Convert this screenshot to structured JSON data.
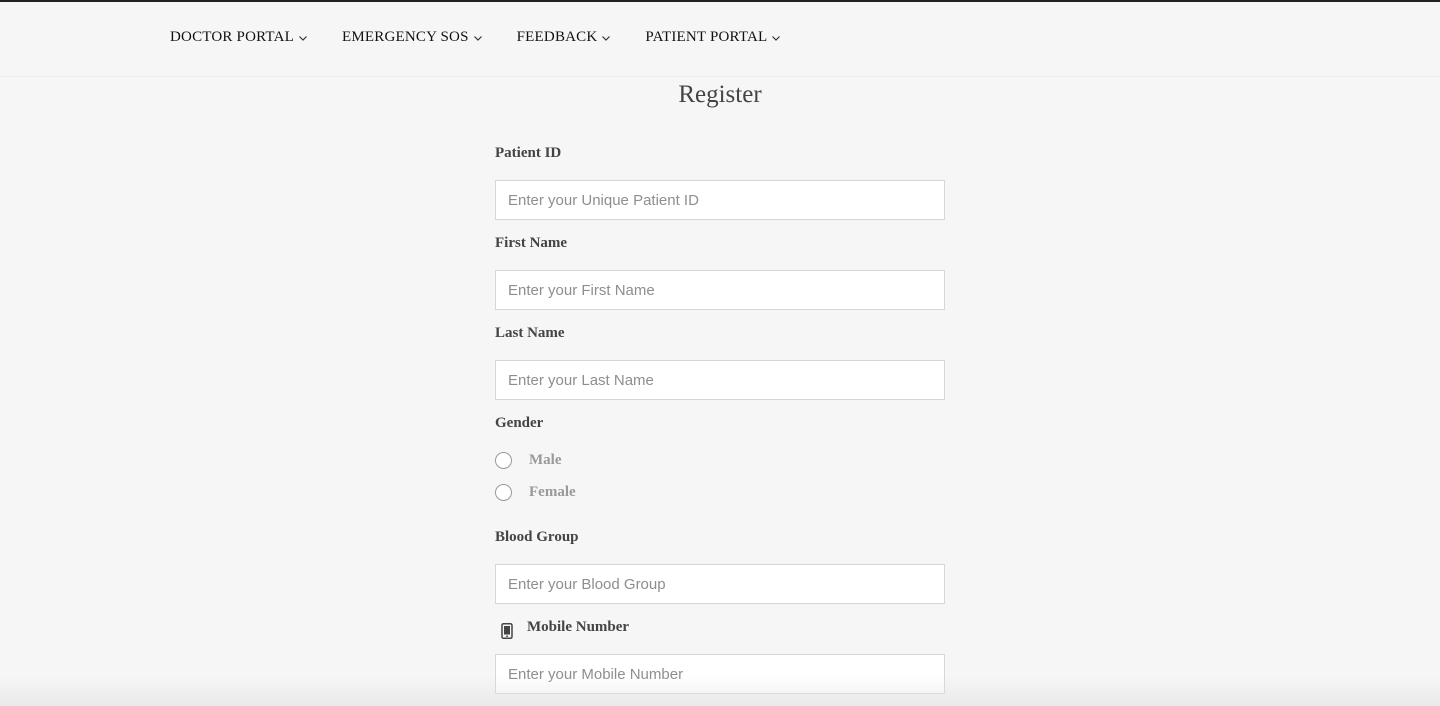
{
  "nav": {
    "items": [
      {
        "label": "DOCTOR PORTAL"
      },
      {
        "label": "EMERGENCY SOS"
      },
      {
        "label": "FEEDBACK"
      },
      {
        "label": "PATIENT PORTAL"
      }
    ]
  },
  "page": {
    "title": "Register"
  },
  "form": {
    "patient_id": {
      "label": "Patient ID",
      "placeholder": "Enter your Unique Patient ID",
      "value": ""
    },
    "first_name": {
      "label": "First Name",
      "placeholder": "Enter your First Name",
      "value": ""
    },
    "last_name": {
      "label": "Last Name",
      "placeholder": "Enter your Last Name",
      "value": ""
    },
    "gender": {
      "label": "Gender",
      "options": [
        {
          "label": "Male",
          "selected": false
        },
        {
          "label": "Female",
          "selected": false
        }
      ]
    },
    "blood_group": {
      "label": "Blood Group",
      "placeholder": "Enter your Blood Group",
      "value": ""
    },
    "mobile": {
      "label": "Mobile Number",
      "icon": "mobile-phone-icon",
      "placeholder": "Enter your Mobile Number",
      "value": ""
    }
  }
}
